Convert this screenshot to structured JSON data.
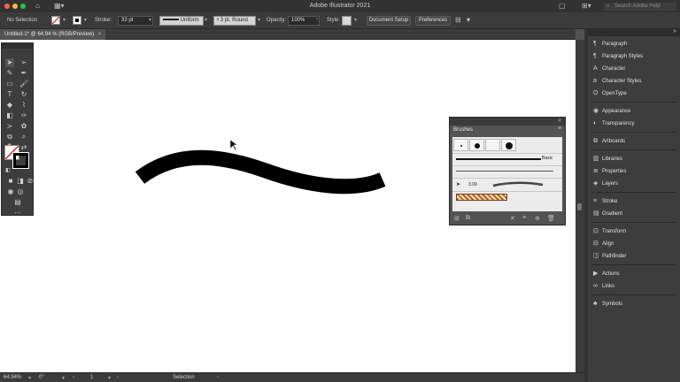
{
  "app": {
    "title": "Adobe Illustrator 2021"
  },
  "titlebar": {
    "search_placeholder": "Search Adobe Help"
  },
  "control": {
    "selection_label": "No Selection",
    "stroke_label": "Stroke:",
    "stroke_value": "33 pt",
    "profile_label": "Uniform",
    "brush_label": "3 pt. Round",
    "opacity_label": "Opacity:",
    "opacity_value": "100%",
    "style_label": "Style:",
    "doc_setup_label": "Document Setup",
    "preferences_label": "Preferences"
  },
  "document": {
    "tab_name": "Untitled-1* @ 64.94 % (RGB/Preview)"
  },
  "status": {
    "zoom": "64.94%",
    "rotation": "0°",
    "artboard": "1",
    "tool": "Selection"
  },
  "brushes": {
    "title": "Brushes",
    "basic_label": "Basic",
    "size_label": "3.00"
  },
  "panels": [
    {
      "icon": "paragraph-icon",
      "label": "Paragraph"
    },
    {
      "icon": "paragraph-styles-icon",
      "label": "Paragraph Styles"
    },
    {
      "icon": "character-icon",
      "label": "Character"
    },
    {
      "icon": "character-styles-icon",
      "label": "Character Styles"
    },
    {
      "icon": "opentype-icon",
      "label": "OpenType"
    },
    {
      "icon": "appearance-icon",
      "label": "Appearance"
    },
    {
      "icon": "transparency-icon",
      "label": "Transparency"
    },
    {
      "icon": "artboards-icon",
      "label": "Artboards"
    },
    {
      "icon": "libraries-icon",
      "label": "Libraries"
    },
    {
      "icon": "properties-icon",
      "label": "Properties"
    },
    {
      "icon": "layers-icon",
      "label": "Layers"
    },
    {
      "icon": "stroke-icon",
      "label": "Stroke"
    },
    {
      "icon": "gradient-icon",
      "label": "Gradient"
    },
    {
      "icon": "transform-icon",
      "label": "Transform"
    },
    {
      "icon": "align-icon",
      "label": "Align"
    },
    {
      "icon": "pathfinder-icon",
      "label": "Pathfinder"
    },
    {
      "icon": "actions-icon",
      "label": "Actions"
    },
    {
      "icon": "links-icon",
      "label": "Links"
    },
    {
      "icon": "symbols-icon",
      "label": "Symbols"
    }
  ]
}
